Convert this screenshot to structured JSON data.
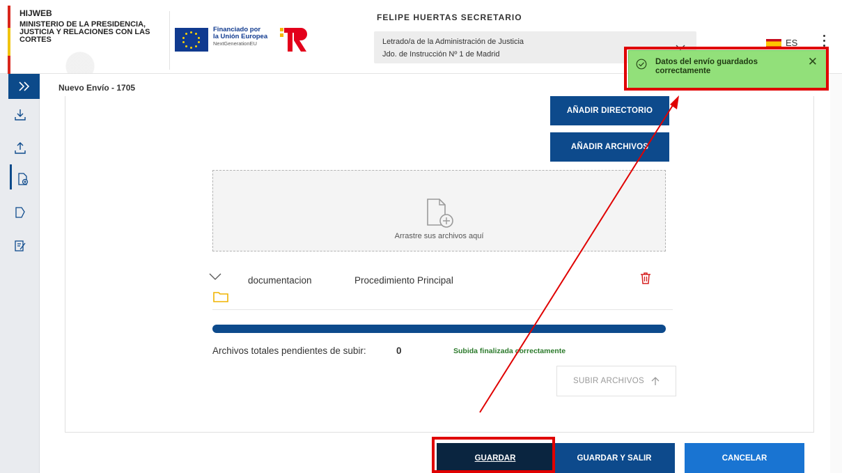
{
  "header": {
    "app_name": "HIJWEB",
    "ministry": "MINISTERIO DE LA PRESIDENCIA, JUSTICIA Y RELACIONES CON LAS CORTES",
    "eu_line1": "Financiado por",
    "eu_line2": "la Unión Europea",
    "eu_line3": "NextGenerationEU",
    "user_name": "FELIPE HUERTAS SECRETARIO",
    "role_line1": "Letrado/a de la Administración de Justicia",
    "role_line2": "Jdo. de Instrucción Nº 1 de Madrid",
    "language": "ES"
  },
  "sidebar": {
    "toggle_icon": "double-chevron-right-icon",
    "items": [
      {
        "icon": "download-icon"
      },
      {
        "icon": "upload-icon"
      },
      {
        "icon": "new-document-icon",
        "active": true
      },
      {
        "icon": "document-edit-icon"
      },
      {
        "icon": "form-edit-icon"
      }
    ]
  },
  "breadcrumb": "Nuevo Envío - 1705",
  "upload": {
    "add_directory": "AÑADIR DIRECTORIO",
    "add_files": "AÑADIR ARCHIVOS",
    "dropzone_text": "Arrastre sus archivos aquí",
    "row": {
      "name": "documentacion",
      "type": "Procedimiento Principal"
    },
    "progress": 1.0,
    "pending_label": "Archivos totales pendientes de subir:",
    "pending_count": "0",
    "status": "Subida finalizada correctamente",
    "upload_button": "SUBIR ARCHIVOS"
  },
  "footer": {
    "save": "GUARDAR",
    "save_exit": "GUARDAR Y SALIR",
    "cancel": "CANCELAR"
  },
  "toast": {
    "message": "Datos del envío guardados correctamente",
    "close": "✕"
  },
  "colors": {
    "primary": "#0d4a8c",
    "dark": "#0a2540",
    "cancel": "#1974d2",
    "toast_bg": "#92e07a",
    "annotation": "#e00000"
  }
}
